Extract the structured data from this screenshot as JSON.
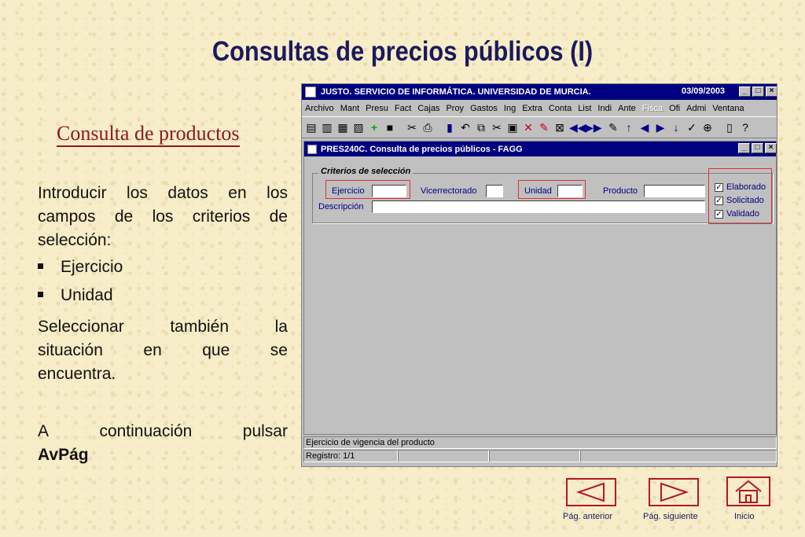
{
  "slide": {
    "title": "Consultas de precios públicos (I)",
    "subtitle": "Consulta de productos",
    "intro": "Introducir los datos en los campos de los criterios de selección:",
    "bullets": [
      "Ejercicio",
      "Unidad"
    ],
    "paragraph2_line1": [
      "Seleccionar",
      "también",
      "la"
    ],
    "paragraph2_line2": [
      "situación",
      "en",
      "que",
      "se"
    ],
    "paragraph2_line3": "encuentra.",
    "paragraph3_line1": [
      "A",
      "continuación",
      "pulsar"
    ],
    "paragraph3_bold": "AvPág"
  },
  "app": {
    "title": "JUSTO. SERVICIO DE INFORMÁTICA. UNIVERSIDAD DE MURCIA.",
    "date": "03/09/2003",
    "menu": [
      "Archivo",
      "Mant",
      "Presu",
      "Fact",
      "Cajas",
      "Proy",
      "Gastos",
      "Ing",
      "Extra",
      "Conta",
      "List",
      "Indi",
      "Ante",
      "Fisca",
      "Ofi",
      "Admi",
      "Ventana"
    ],
    "menu_disabled": "Fisca",
    "child_title": "PRES240C. Consulta de precios públicos - FAGG",
    "group_label": "Criterios de selección",
    "fields": {
      "ejercicio": "Ejercicio",
      "vicerrectorado": "Vicerrectorado",
      "unidad": "Unidad",
      "producto": "Producto",
      "descripcion": "Descripción"
    },
    "checkboxes": [
      {
        "label": "Elaborado",
        "checked": true
      },
      {
        "label": "Solicitado",
        "checked": true
      },
      {
        "label": "Validado",
        "checked": true
      }
    ],
    "status_hint": "Ejercicio de vigencia del producto",
    "status_record": "Registro: 1/1"
  },
  "nav": {
    "prev_label": "Pág. anterior",
    "next_label": "Pág. siguiente",
    "home_label": "Inicio"
  },
  "colors": {
    "title": "#1a1a5e",
    "subtitle": "#8b1a1a",
    "titlebar": "#000080",
    "highlight": "#e03030",
    "nav_border": "#b0182a"
  }
}
